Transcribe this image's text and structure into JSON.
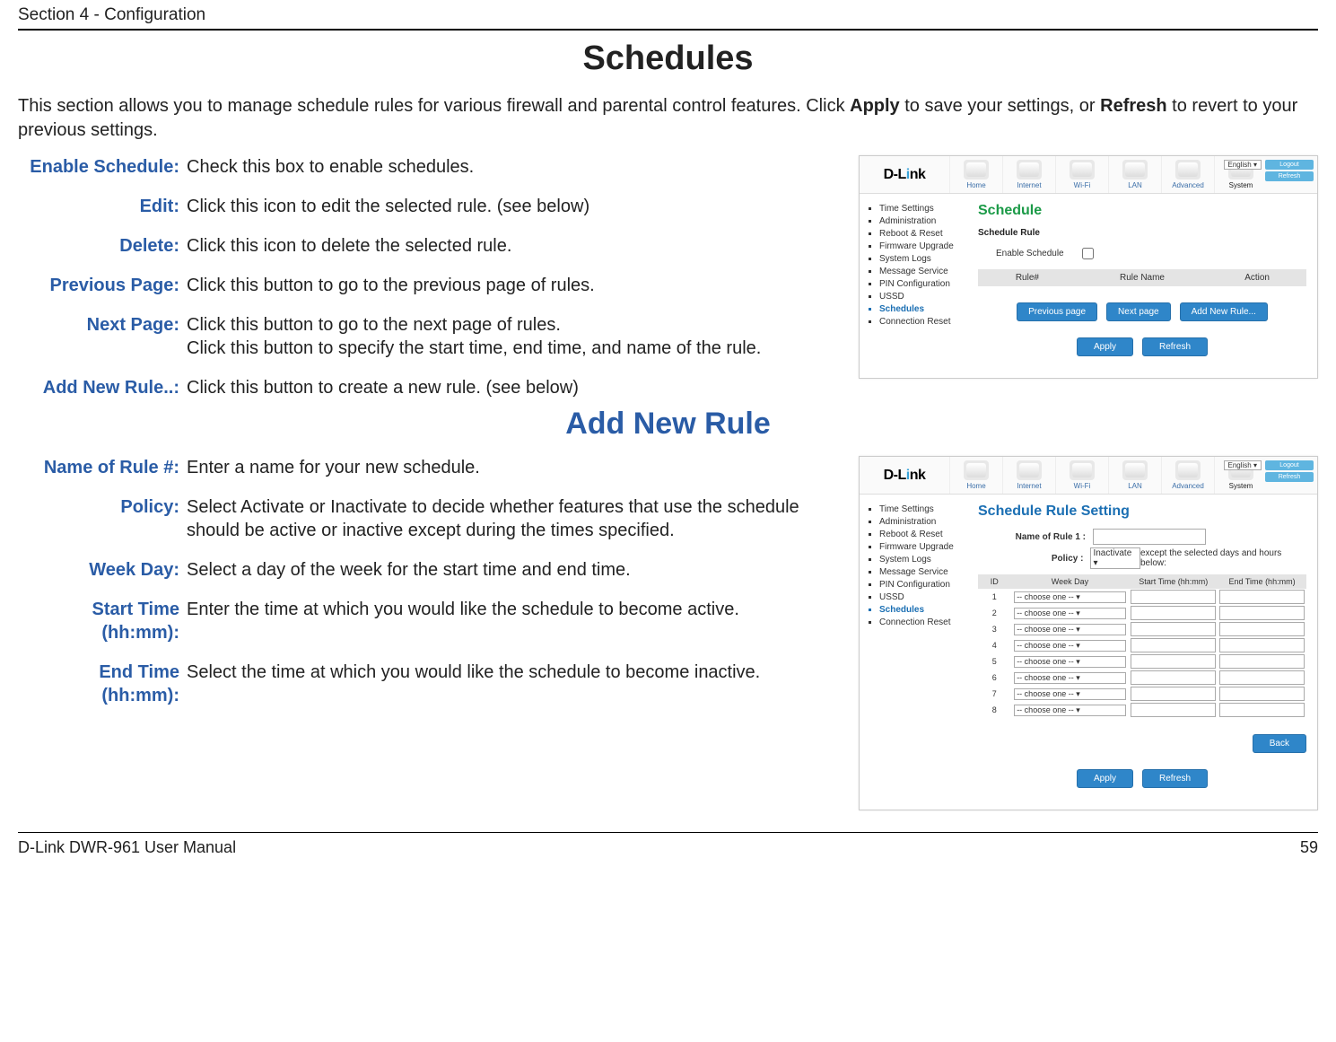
{
  "header": {
    "section": "Section 4 - Configuration"
  },
  "title": "Schedules",
  "intro": {
    "before_apply": "This section allows you to manage schedule rules for various firewall and parental control features. Click ",
    "apply": "Apply",
    "between": " to save your settings, or ",
    "refresh": "Refresh",
    "after": " to revert to your previous settings."
  },
  "defs1": [
    {
      "label": "Enable Schedule:",
      "desc": "Check this box to enable schedules."
    },
    {
      "label": "Edit:",
      "desc": "Click this icon to edit the selected rule. (see below)"
    },
    {
      "label": "Delete:",
      "desc": "Click this icon to delete the selected rule."
    },
    {
      "label": "Previous Page:",
      "desc": "Click this button to go to the previous page of rules."
    },
    {
      "label": "Next Page:",
      "desc": "Click this button to go to the next page of rules.\nClick this button to specify the start time, end time, and name of the rule."
    },
    {
      "label": "Add New Rule..:",
      "desc": "Click this button to create a new rule. (see below)"
    }
  ],
  "subtitle": "Add New Rule",
  "defs2": [
    {
      "label": "Name of Rule #:",
      "desc": "Enter a name for your new schedule."
    },
    {
      "label": "Policy:",
      "desc": "Select Activate or Inactivate to decide whether features that use the schedule should be active or inactive except during the times specified."
    },
    {
      "label": "Week Day:",
      "desc": "Select a day of the week for the start time and end time."
    },
    {
      "label": "Start Time (hh:mm):",
      "desc": "Enter the time at which you would like the schedule to become active."
    },
    {
      "label": "End Time (hh:mm):",
      "desc": "Select the time at which you would like the schedule to become inactive."
    }
  ],
  "router": {
    "brand": "D-Link",
    "lang": "English ▾",
    "auth": {
      "logout": "Logout",
      "refresh": "Refresh"
    },
    "nav": [
      "Home",
      "Internet",
      "Wi-Fi",
      "LAN",
      "Advanced",
      "System"
    ],
    "side": [
      "Time Settings",
      "Administration",
      "Reboot & Reset",
      "Firmware Upgrade",
      "System Logs",
      "Message Service",
      "PIN Configuration",
      "USSD",
      "Schedules",
      "Connection Reset"
    ],
    "side_selected": "Schedules",
    "shot1": {
      "title": "Schedule",
      "subtitle": "Schedule Rule",
      "enable_label": "Enable Schedule",
      "cols": [
        "Rule#",
        "Rule Name",
        "Action"
      ],
      "buttons": {
        "prev": "Previous page",
        "next": "Next page",
        "add": "Add New Rule...",
        "apply": "Apply",
        "refresh": "Refresh"
      }
    },
    "shot2": {
      "title": "Schedule Rule Setting",
      "name_label": "Name of Rule 1 :",
      "policy_label": "Policy :",
      "policy_value": "Inactivate ▾",
      "policy_tail": " except the selected days and hours below:",
      "cols": [
        "ID",
        "Week Day",
        "Start Time (hh:mm)",
        "End Time (hh:mm)"
      ],
      "choose": "-- choose one -- ▾",
      "ids": [
        "1",
        "2",
        "3",
        "4",
        "5",
        "6",
        "7",
        "8"
      ],
      "buttons": {
        "back": "Back",
        "apply": "Apply",
        "refresh": "Refresh"
      }
    }
  },
  "footer": {
    "left": "D-Link DWR-961 User Manual",
    "right": "59"
  }
}
